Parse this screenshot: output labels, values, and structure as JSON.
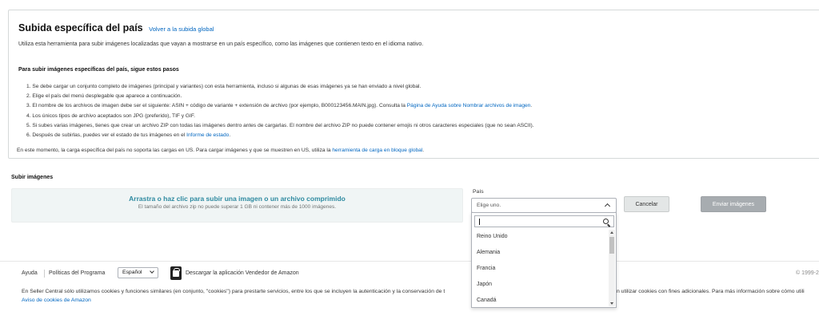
{
  "info": {
    "title": "Subida específica del país",
    "back_link": "Volver a la subida global",
    "intro": "Utiliza esta herramienta para subir imágenes localizadas que vayan a mostrarse en un país específico, como las imágenes que contienen texto en el idioma nativo.",
    "steps_heading": "Para subir imágenes específicas del país, sigue estos pasos",
    "steps": [
      "1. Se debe cargar un conjunto completo de imágenes (principal y variantes) con esta herramienta, incluso si algunas de esas imágenes ya se han enviado a nivel global.",
      "2. Elige el país del menú desplegable que aparece a continuación.",
      "3. El nombre de los archivos de imagen debe ser el siguiente: ASIN + código de variante + extensión de archivo (por ejemplo, B000123456.MAIN.jpg). Consulta la",
      "4. Los únicos tipos de archivo aceptados son JPG (preferido), TIF y GIF.",
      "5. Si subes varias imágenes, tienes que crear un archivo ZIP con todas las imágenes dentro antes de cargarlas. El nombre del archivo ZIP no puede contener emojis ni otros caracteres especiales (que no sean ASCII).",
      "6. Después de subirlas, puedes ver el estado de tus imágenes en el"
    ],
    "step3_link": "Página de Ayuda sobre Nombrar archivos de imagen",
    "step6_link": "Informe de estado",
    "note": "En este momento, la carga específica del país no soporta las cargas en US. Para cargar imágenes y que se muestren en US, utiliza la",
    "note_link": "herramienta de carga en bloque global"
  },
  "upload": {
    "heading": "Subir imágenes",
    "drop_main": "Arrastra o haz clic para subir una imagen o un archivo comprimido",
    "drop_sub": "El tamaño del archivo zip no puede superar 1 GB ni contener más de 1000 imágenes."
  },
  "country": {
    "label": "País",
    "placeholder": "Elige uno.",
    "search_value": "",
    "options": [
      "Reino Unido",
      "Alemania",
      "Francia",
      "Japón",
      "Canadá"
    ]
  },
  "buttons": {
    "cancel": "Cancelar",
    "submit": "Enviar imágenes"
  },
  "footer": {
    "help": "Ayuda",
    "policies": "Políticas del Programa",
    "language": "Español",
    "app_download": "Descargar la aplicación Vendedor de Amazon",
    "copyright": "© 1999-2",
    "cookie_left": "En Seller Central sólo utilizamos cookies y funciones similares (en conjunto, \"cookies\") para prestarte servicios, entre los que se incluyen la autenticación y la conservación de t",
    "cookie_right": "n utilizar cookies con fines adicionales. Para más información sobre cómo utili",
    "cookie_link": "Aviso de cookies de Amazon"
  },
  "colors": {
    "link": "#0066c0",
    "dropzone_bg": "#f0f5f5",
    "dropzone_text": "#2e8aa0",
    "submit_disabled": "#a7acb0"
  }
}
